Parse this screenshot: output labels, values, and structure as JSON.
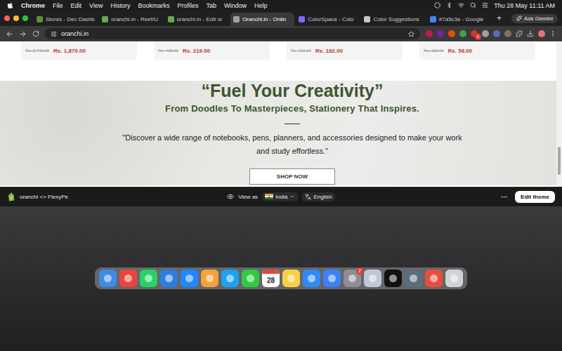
{
  "menu_bar": {
    "app": "Chrome",
    "items": [
      "File",
      "Edit",
      "View",
      "History",
      "Bookmarks",
      "Profiles",
      "Tab",
      "Window",
      "Help"
    ],
    "clock": "Thu 28 May 11:11 AM"
  },
  "tabs": [
    {
      "label": "Stores - Dev Dashb",
      "selected": false,
      "color": "#5e8e3e"
    },
    {
      "label": "oranchi.in - Reef/U",
      "selected": false,
      "color": "#6aa84f"
    },
    {
      "label": "oranchi.in - Edit or",
      "selected": false,
      "color": "#6aa84f"
    },
    {
      "label": "Oranchi.in - Onlin",
      "selected": true,
      "color": "#9aa0a6"
    },
    {
      "label": "ColorSpace - Colo",
      "selected": false,
      "color": "#7c6cf2"
    },
    {
      "label": "Color Suggestions",
      "selected": false,
      "color": "#c7c7c7"
    },
    {
      "label": "#7a5c3e - Google",
      "selected": false,
      "color": "#4285f4"
    }
  ],
  "new_tab": "+",
  "gemini": "Ask Gemini",
  "address_bar": {
    "url": "oranchi.in"
  },
  "extensions": [
    {
      "color": "#c2185b"
    },
    {
      "color": "#7b1fa2"
    },
    {
      "color": "#e65100"
    },
    {
      "color": "#43a047"
    },
    {
      "color": "#d93025",
      "badge": "2"
    },
    {
      "color": "#9e9e9e"
    },
    {
      "color": "#5c6bc0"
    },
    {
      "color": "#8d6e63"
    }
  ],
  "products": [
    {
      "old_price": "Rs. 2,740.00",
      "price": "Rs. 1,870.00"
    },
    {
      "old_price": "Rs. 425.00",
      "price": "Rs. 219.00"
    },
    {
      "old_price": "Rs. 422.00",
      "price": "Rs. 182.00"
    },
    {
      "old_price": "Rs. 115.00",
      "price": "Rs. 58.00"
    }
  ],
  "banner": {
    "title": "“Fuel Your Creativity”",
    "subtitle": "From Doodles To Masterpieces, Stationery That Inspires.",
    "text": "\"Discover a wide range of notebooks, pens, planners, and accessories designed to make your work and study effortless.\"",
    "button": "SHOP NOW"
  },
  "editor_bar": {
    "store": "oranchi <> FlexyPe",
    "view_as": "View as",
    "country": "India",
    "language": "English",
    "edit_button": "Edit theme"
  },
  "dock": [
    {
      "name": "finder",
      "color": "#3d8ae8"
    },
    {
      "name": "chrome",
      "color": "#e8453c"
    },
    {
      "name": "whatsapp",
      "color": "#25d366"
    },
    {
      "name": "vscode",
      "color": "#2b7de0"
    },
    {
      "name": "app-store",
      "color": "#1e88ff"
    },
    {
      "name": "photos",
      "color": "#f2a33a"
    },
    {
      "name": "safari",
      "color": "#1da1f2"
    },
    {
      "name": "facetime",
      "color": "#2ecc40"
    },
    {
      "name": "calendar",
      "color": "#ffffff",
      "label": "28"
    },
    {
      "name": "notes",
      "color": "#f7d046"
    },
    {
      "name": "mail",
      "color": "#2f8af5"
    },
    {
      "name": "qbittorrent",
      "color": "#3b82f6"
    },
    {
      "name": "settings",
      "color": "#8e8e93",
      "badge": "2"
    },
    {
      "name": "preview",
      "color": "#c0c8d8"
    },
    {
      "name": "terminal",
      "color": "#111111"
    },
    {
      "name": "utility",
      "color": "#5a6d80"
    },
    {
      "name": "anydesk",
      "color": "#e84d3d"
    },
    {
      "name": "trash",
      "color": "#cfd3d8"
    }
  ]
}
